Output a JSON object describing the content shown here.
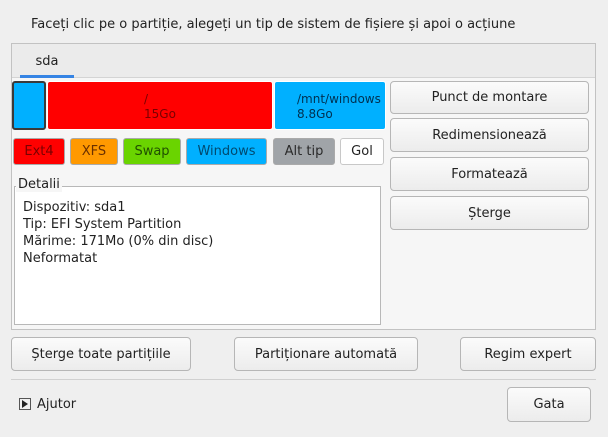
{
  "instruction": "Faceți clic pe o partiție, alegeți un tip de sistem de fișiere și apoi o acțiune",
  "disk_tab": "sda",
  "partitions": [
    {
      "mount": "",
      "size": "",
      "color": "#00b0ff",
      "selected": true
    },
    {
      "mount": "/",
      "size": "15Go",
      "color": "#ff0000",
      "text_color": "#7a0000"
    },
    {
      "mount": "/mnt/windows",
      "size": "8.8Go",
      "color": "#00b0ff",
      "text_color": "#003050"
    }
  ],
  "fs_types": [
    {
      "label": "Ext4",
      "bg": "#ff0000",
      "fg": "#7a0000"
    },
    {
      "label": "XFS",
      "bg": "#ff9900",
      "fg": "#6a3000"
    },
    {
      "label": "Swap",
      "bg": "#6ad400",
      "fg": "#205000"
    },
    {
      "label": "Windows",
      "bg": "#00b0ff",
      "fg": "#004a70"
    },
    {
      "label": "Alt tip",
      "bg": "#a0a4a8",
      "fg": "#2a2a2a"
    },
    {
      "label": "Gol",
      "bg": "#ffffff",
      "fg": "#222222"
    }
  ],
  "details": {
    "legend": "Detalii",
    "lines": [
      "Dispozitiv: sda1",
      "Tip: EFI System Partition",
      "Mărime: 171Mo (0% din disc)",
      "Neformatat"
    ]
  },
  "actions": {
    "mount_point": "Punct de montare",
    "resize": "Redimensionează",
    "format": "Formatează",
    "delete": "Șterge"
  },
  "bottom": {
    "delete_all": "Șterge toate partițiile",
    "auto": "Partiționare automată",
    "expert": "Regim expert"
  },
  "footer": {
    "help": "Ajutor",
    "done": "Gata"
  },
  "colors": {
    "tab_accent": "#3584e4"
  }
}
